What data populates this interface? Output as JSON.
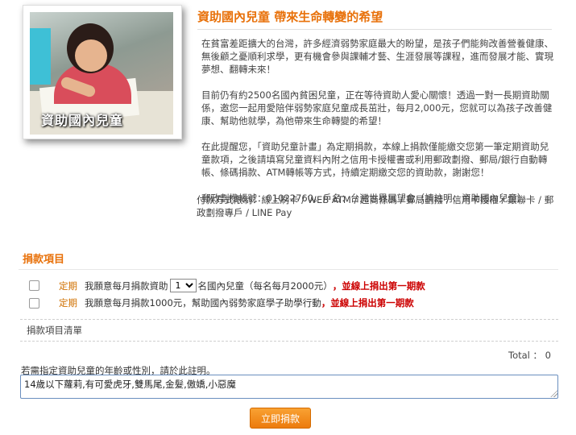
{
  "intro": {
    "photo_caption": "資助國內兒童",
    "title": "資助國內兒童 帶來生命轉變的希望",
    "paragraph1": "在貧富差距擴大的台灣，許多經濟弱勢家庭最大的盼望，是孩子們能夠改善營養健康、無後顧之憂順利求學，更有機會參與課輔才藝、生涯發展等課程，進而發展才能、實現夢想、翻轉未來！",
    "paragraph2": "目前仍有約2500名國內貧困兒童，正在等待資助人愛心關懷！透過一對一長期資助關係，邀您一起用愛陪伴弱勢家庭兒童成長茁壯，每月2,000元，您就可以為孩子改善健康、幫助他就學，為他帶來生命轉變的希望！",
    "paragraph3": "在此提醒您，「資助兒童計畫」為定期捐款，本線上捐款僅能繳交您第一筆定期資助兒童款項，之後請填寫兒童資料內附之信用卡授權書或利用郵政劃撥、郵局/銀行自動轉帳、條碼捐款、ATM轉帳等方式，持續定期繳交您的資助款，謝謝您！",
    "account": "郵政劃撥帳號：01022760。戶名：台灣世界展望會（請註明：資助國內兒童）",
    "payment_methods": "付款方式限制：線上刷卡 / WEB ATM / 超商條碼 / 郵局劃撥 / 信用卡授權 / 銀聯卡 / 郵政劃撥專戶 / LINE Pay"
  },
  "donation": {
    "section_title": "捐款項目",
    "items": [
      {
        "tag": "定期",
        "text_before": "我願意每月捐款資助",
        "select_value": "1",
        "text_after": "名國內兒童（每名每月2000元）",
        "highlight": "，並線上捐出第一期款",
        "checked": false
      },
      {
        "tag": "定期",
        "text_before": "我願意每月捐款1000元，幫助國內弱勢家庭學子助學行動",
        "highlight": "，並線上捐出第一期款",
        "checked": false
      }
    ],
    "list_header": "捐款項目清單",
    "total_label": "Total ：",
    "total_value": "0",
    "note_label": "若需指定資助兒童的年齡或性別，請於此註明。",
    "note_value": "14歲以下蘿莉,有可愛虎牙,雙馬尾,金髮,傲嬌,小惡魔",
    "submit_label": "立即捐款"
  },
  "colors": {
    "accent": "#e8710a",
    "highlight_red": "#cc0000",
    "button": "#ec7b0c"
  }
}
